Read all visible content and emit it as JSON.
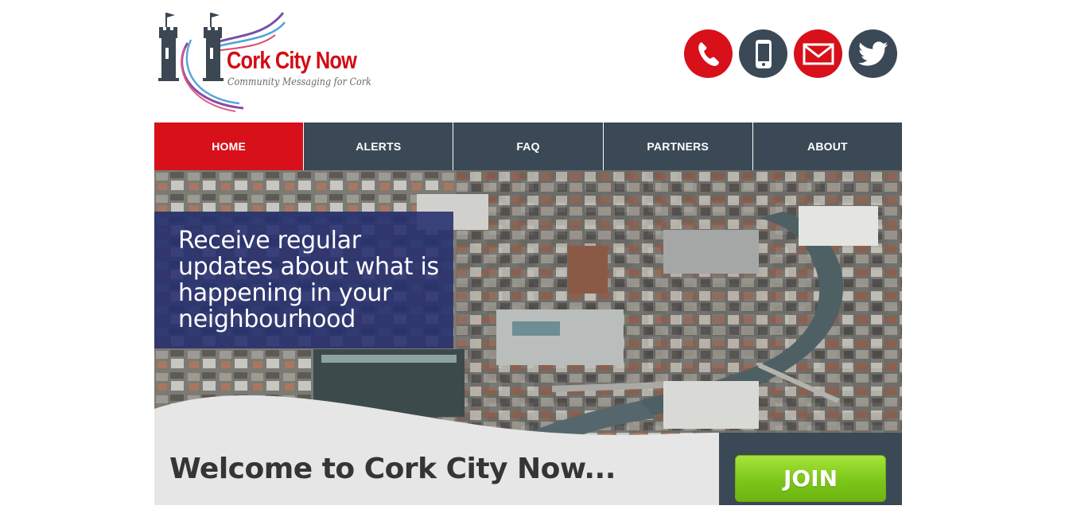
{
  "brand": {
    "title": "Cork City Now",
    "tagline": "Community Messaging for Cork",
    "accent_red": "#d7101a",
    "slate": "#3a4955"
  },
  "contacts": [
    {
      "icon": "phone-icon",
      "color": "#d7101a"
    },
    {
      "icon": "mobile-icon",
      "color": "#3a4955"
    },
    {
      "icon": "mail-icon",
      "color": "#d7101a"
    },
    {
      "icon": "twitter-icon",
      "color": "#3a4955"
    }
  ],
  "nav": {
    "items": [
      {
        "label": "HOME",
        "active": true
      },
      {
        "label": "ALERTS",
        "active": false
      },
      {
        "label": "FAQ",
        "active": false
      },
      {
        "label": "PARTNERS",
        "active": false
      },
      {
        "label": "ABOUT",
        "active": false
      }
    ]
  },
  "hero": {
    "headline": "Receive regular updates about what is happening in your neighbourhood"
  },
  "welcome": {
    "heading": "Welcome to Cork City Now...",
    "join_label": "JOIN"
  }
}
